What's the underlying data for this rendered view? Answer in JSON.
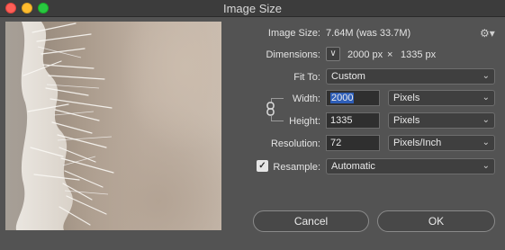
{
  "window": {
    "title": "Image Size"
  },
  "image_size": {
    "label": "Image Size:",
    "value": "7.64M (was 33.7M)"
  },
  "dimensions": {
    "label": "Dimensions:",
    "width": "2000 px",
    "times": "×",
    "height": "1335 px"
  },
  "fit_to": {
    "label": "Fit To:",
    "value": "Custom"
  },
  "width": {
    "label": "Width:",
    "value": "2000",
    "unit": "Pixels"
  },
  "height": {
    "label": "Height:",
    "value": "1335",
    "unit": "Pixels"
  },
  "resolution": {
    "label": "Resolution:",
    "value": "72",
    "unit": "Pixels/Inch"
  },
  "resample": {
    "label": "Resample:",
    "checked": true,
    "value": "Automatic"
  },
  "buttons": {
    "cancel": "Cancel",
    "ok": "OK"
  },
  "icons": {
    "gear": "gear-icon",
    "dimensions_toggle": "chevron-down-icon",
    "constrain": "link-icon",
    "dropdown": "chevron-updown-icon"
  }
}
